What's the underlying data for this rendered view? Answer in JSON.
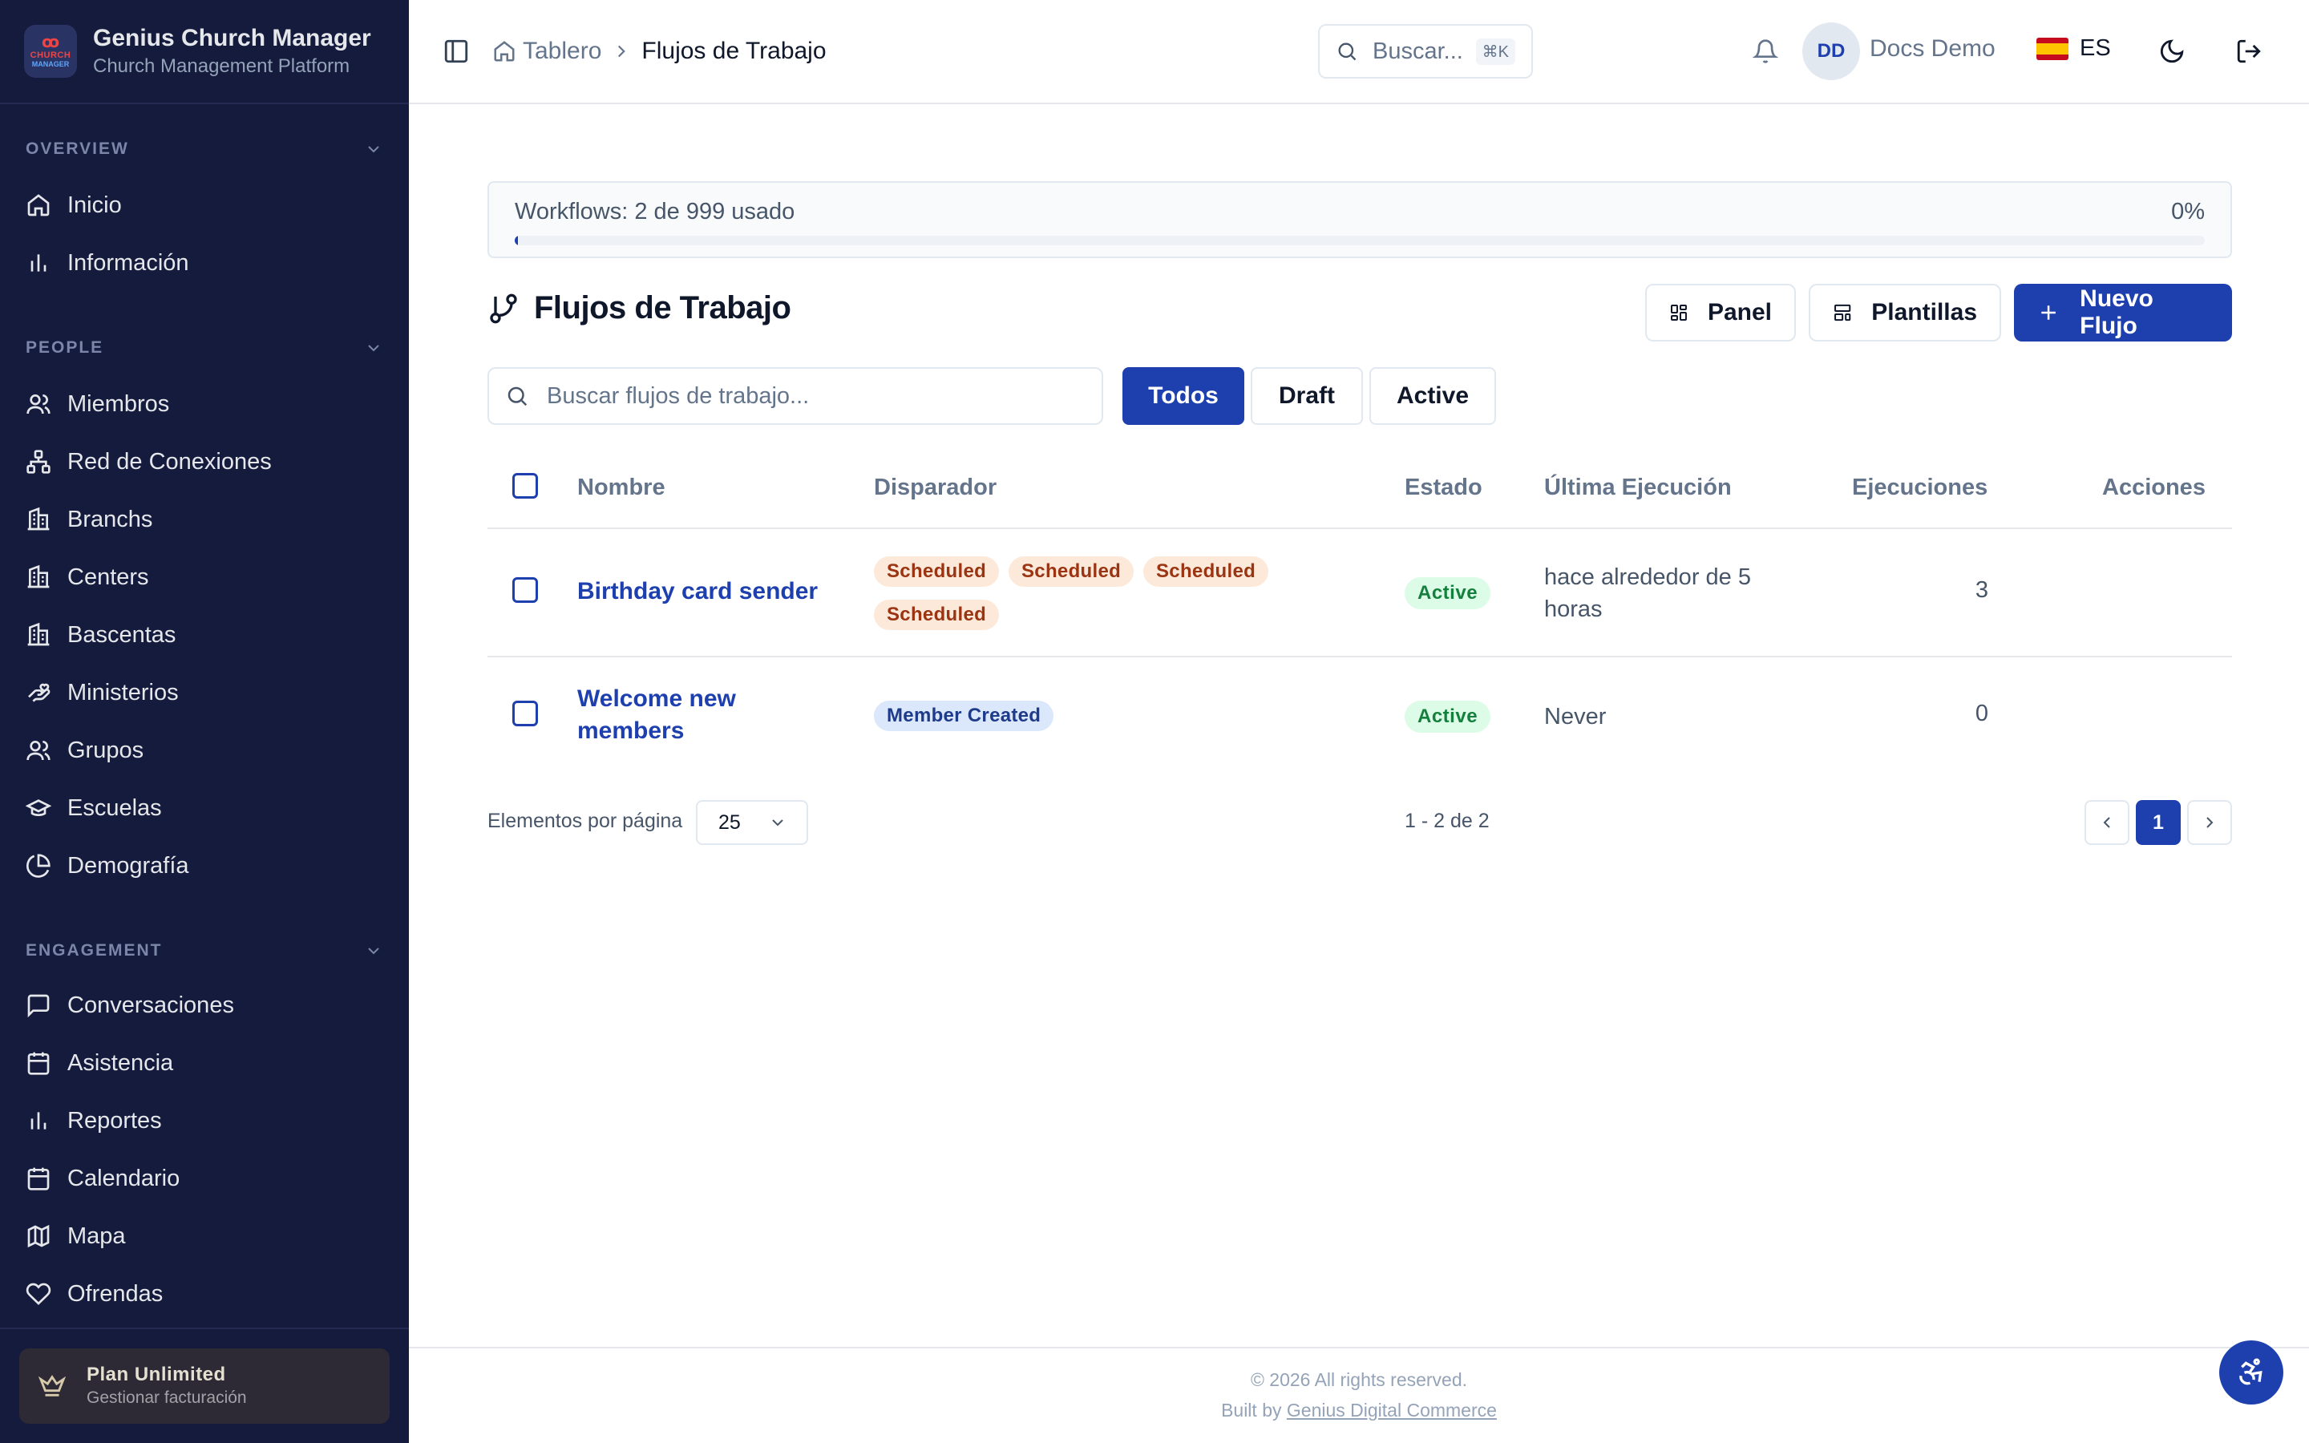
{
  "brand": {
    "logo_line1": "ꝏ",
    "logo_line2": "CHURCH",
    "logo_line3": "MANAGER",
    "title": "Genius Church Manager",
    "subtitle": "Church Management Platform"
  },
  "sidebar": {
    "sections": [
      {
        "title": "OVERVIEW",
        "items": [
          {
            "label": "Inicio",
            "icon": "home-icon"
          },
          {
            "label": "Información",
            "icon": "bar-chart-icon"
          }
        ]
      },
      {
        "title": "PEOPLE",
        "items": [
          {
            "label": "Miembros",
            "icon": "users-icon"
          },
          {
            "label": "Red de Conexiones",
            "icon": "network-icon"
          },
          {
            "label": "Branchs",
            "icon": "building-icon"
          },
          {
            "label": "Centers",
            "icon": "building-icon"
          },
          {
            "label": "Bascentas",
            "icon": "building-icon"
          },
          {
            "label": "Ministerios",
            "icon": "hand-heart-icon"
          },
          {
            "label": "Grupos",
            "icon": "users-icon"
          },
          {
            "label": "Escuelas",
            "icon": "graduation-cap-icon"
          },
          {
            "label": "Demografía",
            "icon": "pie-chart-icon"
          }
        ]
      },
      {
        "title": "ENGAGEMENT",
        "items": [
          {
            "label": "Conversaciones",
            "icon": "message-square-icon"
          },
          {
            "label": "Asistencia",
            "icon": "calendar-icon"
          },
          {
            "label": "Reportes",
            "icon": "bar-chart-icon"
          },
          {
            "label": "Calendario",
            "icon": "calendar-days-icon"
          },
          {
            "label": "Mapa",
            "icon": "map-icon"
          },
          {
            "label": "Ofrendas",
            "icon": "heart-icon"
          }
        ]
      }
    ],
    "plan": {
      "title": "Plan Unlimited",
      "subtitle": "Gestionar facturación",
      "icon": "crown-icon"
    }
  },
  "header": {
    "breadcrumb": {
      "root": "Tablero",
      "current": "Flujos de Trabajo"
    },
    "search": {
      "placeholder": "Buscar...",
      "shortcut": "⌘K"
    },
    "user": {
      "initials": "DD",
      "name": "Docs Demo"
    },
    "language": "ES"
  },
  "usage": {
    "text": "Workflows: 2 de 999 usado",
    "percent_label": "0%",
    "fraction": 0.002
  },
  "page": {
    "title": "Flujos de Trabajo",
    "buttons": {
      "panel": "Panel",
      "templates": "Plantillas",
      "new": "Nuevo Flujo"
    },
    "filter_placeholder": "Buscar flujos de trabajo...",
    "filters": [
      "Todos",
      "Draft",
      "Active"
    ],
    "active_filter": "Todos"
  },
  "table": {
    "columns": [
      "Nombre",
      "Disparador",
      "Estado",
      "Última Ejecución",
      "Ejecuciones",
      "Acciones"
    ],
    "rows": [
      {
        "name": "Birthday card sender",
        "triggers": [
          "Scheduled",
          "Scheduled",
          "Scheduled",
          "Scheduled"
        ],
        "status": "Active",
        "last_run": "hace alrededor de 5 horas",
        "runs": "3"
      },
      {
        "name": "Welcome new members",
        "triggers": [
          "Member Created"
        ],
        "status": "Active",
        "last_run": "Never",
        "runs": "0"
      }
    ]
  },
  "pagination": {
    "per_page_label": "Elementos por página",
    "per_page_value": "25",
    "range": "1 - 2 de 2",
    "current_page": "1"
  },
  "footer": {
    "copyright": "© 2026 All rights reserved.",
    "built_by": "Built by",
    "built_by_link": "Genius Digital Commerce"
  },
  "colors": {
    "sidebar_bg": "#141b3d",
    "primary": "#1e40af",
    "active_bg": "#dcfce7",
    "scheduled_bg": "#fde9d9"
  }
}
